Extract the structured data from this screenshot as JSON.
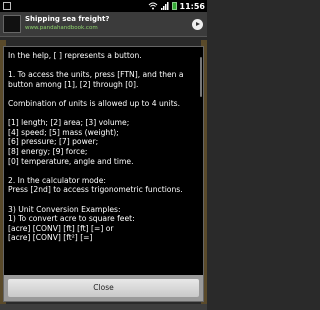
{
  "status_bar": {
    "time": "11:56"
  },
  "ad": {
    "title": "Shipping sea freight?",
    "url": "www.pandahandbook.com"
  },
  "dialog": {
    "lines": [
      "In the help, [ ] represents a button.",
      "",
      "1. To access the units, press [FTN], and then a button among [1], [2] through [0].",
      "",
      "Combination of units is allowed up to 4 units.",
      "",
      "[1] length; [2] area; [3] volume;",
      "[4] speed; [5] mass (weight);",
      "[6] pressure; [7] power;",
      "[8] energy; [9] force;",
      "[0] temperature, angle and time.",
      "",
      "2. In the calculator mode:",
      "Press [2nd] to access trigonometric functions.",
      "",
      "3) Unit Conversion Examples:",
      "1) To convert acre to square feet:",
      "[acre] [CONV] [ft] [ft] [=] or",
      "[acre] [CONV] [ft²] [=]"
    ],
    "close_label": "Close"
  }
}
